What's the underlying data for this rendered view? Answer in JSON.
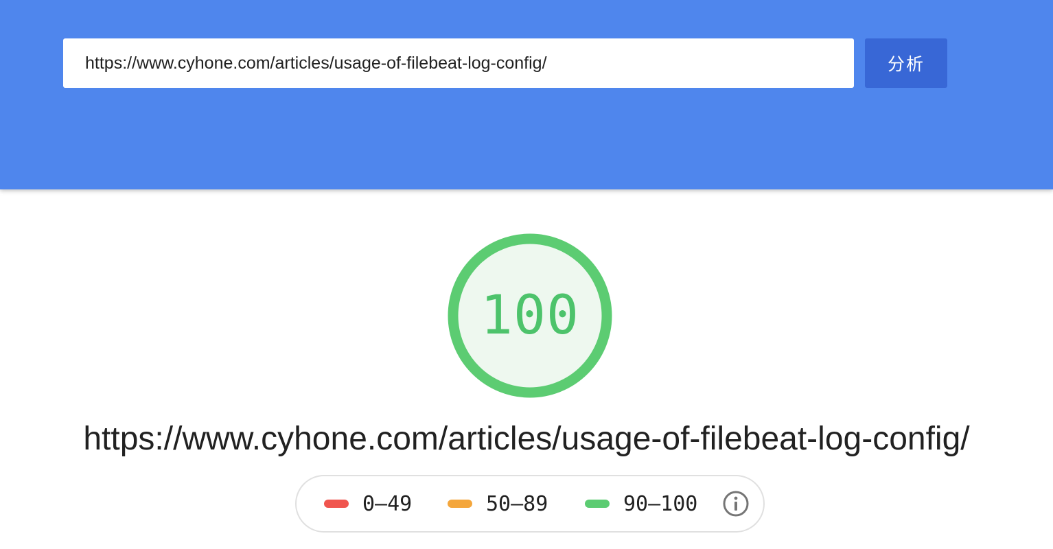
{
  "search": {
    "url_value": "https://www.cyhone.com/articles/usage-of-filebeat-log-config/",
    "analyze_label": "分析"
  },
  "report": {
    "score": "100",
    "score_fraction": 1.0,
    "url": "https://www.cyhone.com/articles/usage-of-filebeat-log-config/"
  },
  "legend": {
    "items": [
      {
        "label": "0–49",
        "color": "#f0554e"
      },
      {
        "label": "50–89",
        "color": "#f4a63b"
      },
      {
        "label": "90–100",
        "color": "#5ccc72"
      }
    ],
    "info_icon": "info-icon"
  },
  "colors": {
    "header_bg": "#4f86ed",
    "button_bg": "#3867d6",
    "gauge_ring": "#5ccc72",
    "gauge_fill": "#eef8ef",
    "gauge_text": "#4dc36b"
  }
}
